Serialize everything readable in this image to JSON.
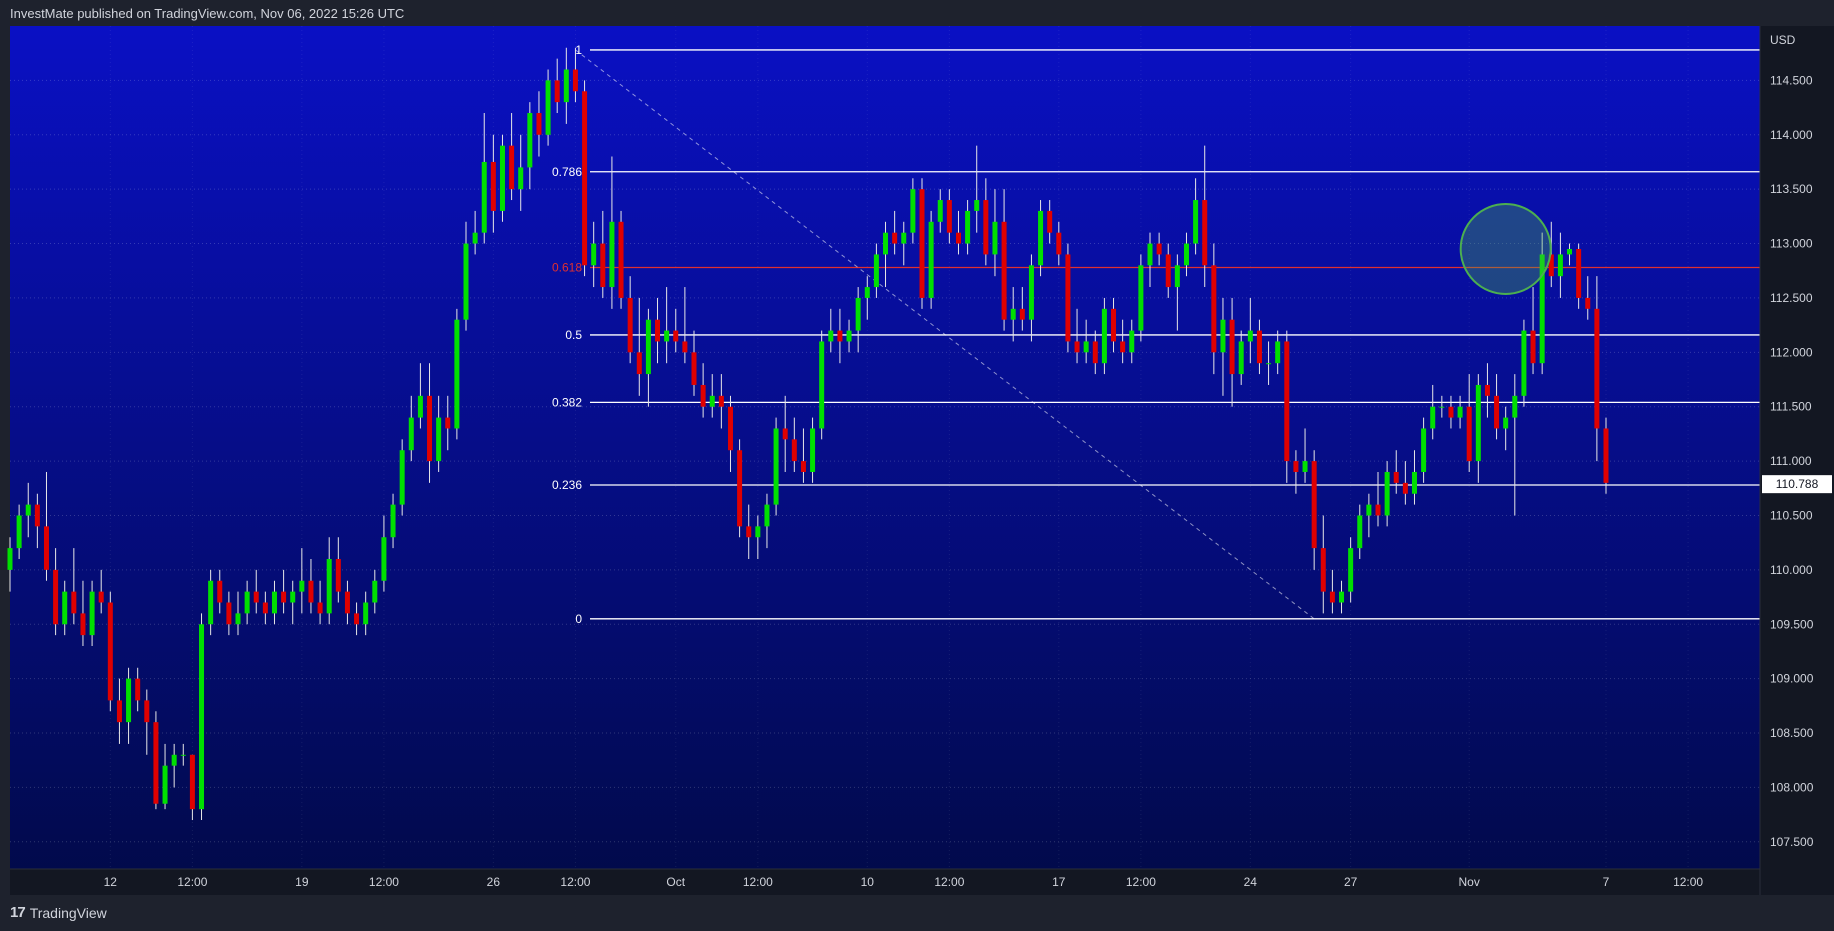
{
  "header": {
    "text": "InvestMate published on TradingView.com, Nov 06, 2022 15:26 UTC"
  },
  "footer": {
    "logo_mark": "17",
    "logo_text": "TradingView"
  },
  "colors": {
    "bg_top": "#0a10c4",
    "bg_bottom": "#010a48",
    "up": "#00e000",
    "down": "#e00000",
    "wick": "#e8e8e8",
    "fib": "#ffffff",
    "fib_highlight": "#e03030",
    "circle": "#4caf50"
  },
  "chart_data": {
    "type": "candlestick",
    "title": "",
    "currency": "USD",
    "last_price": "110.788",
    "ylim": [
      107.25,
      115.0
    ],
    "y_ticks": [
      "107.500",
      "108.000",
      "108.500",
      "109.000",
      "109.500",
      "110.000",
      "110.500",
      "111.000",
      "111.500",
      "112.000",
      "112.500",
      "113.000",
      "113.500",
      "114.000",
      "114.500"
    ],
    "x_ticks": [
      {
        "label": "12",
        "i": 11
      },
      {
        "label": "12:00",
        "i": 20
      },
      {
        "label": "19",
        "i": 32
      },
      {
        "label": "12:00",
        "i": 41
      },
      {
        "label": "26",
        "i": 53
      },
      {
        "label": "12:00",
        "i": 62
      },
      {
        "label": "Oct",
        "i": 73
      },
      {
        "label": "12:00",
        "i": 82
      },
      {
        "label": "10",
        "i": 94
      },
      {
        "label": "12:00",
        "i": 103
      },
      {
        "label": "17",
        "i": 115
      },
      {
        "label": "12:00",
        "i": 124
      },
      {
        "label": "24",
        "i": 136
      },
      {
        "label": "27",
        "i": 147
      },
      {
        "label": "Nov",
        "i": 160
      },
      {
        "label": "7",
        "i": 175
      },
      {
        "label": "12:00",
        "i": 184
      }
    ],
    "fibonacci": {
      "high": 114.78,
      "low": 109.55,
      "levels": [
        {
          "label": "1",
          "price": 114.78
        },
        {
          "label": "0.786",
          "price": 113.66
        },
        {
          "label": "0.618",
          "price": 112.78,
          "highlight": true
        },
        {
          "label": "0.5",
          "price": 112.16
        },
        {
          "label": "0.382",
          "price": 111.54
        },
        {
          "label": "0.236",
          "price": 110.78
        },
        {
          "label": "0",
          "price": 109.55
        }
      ]
    },
    "annotation_circle": {
      "i": 164,
      "price": 112.95
    },
    "trend_line": {
      "from": {
        "i": 62,
        "price": 114.78
      },
      "to": {
        "i": 143,
        "price": 109.55
      }
    },
    "candles": [
      [
        110.0,
        110.3,
        109.8,
        110.2
      ],
      [
        110.2,
        110.6,
        110.1,
        110.5
      ],
      [
        110.5,
        110.8,
        110.3,
        110.6
      ],
      [
        110.6,
        110.7,
        110.2,
        110.4
      ],
      [
        110.4,
        110.9,
        109.9,
        110.0
      ],
      [
        110.0,
        110.2,
        109.4,
        109.5
      ],
      [
        109.5,
        109.9,
        109.4,
        109.8
      ],
      [
        109.8,
        110.2,
        109.5,
        109.6
      ],
      [
        109.6,
        109.9,
        109.3,
        109.4
      ],
      [
        109.4,
        109.9,
        109.3,
        109.8
      ],
      [
        109.8,
        110.0,
        109.6,
        109.7
      ],
      [
        109.7,
        109.8,
        108.7,
        108.8
      ],
      [
        108.8,
        109.0,
        108.4,
        108.6
      ],
      [
        108.6,
        109.1,
        108.4,
        109.0
      ],
      [
        109.0,
        109.1,
        108.7,
        108.8
      ],
      [
        108.8,
        108.9,
        108.3,
        108.6
      ],
      [
        108.6,
        108.7,
        107.8,
        107.85
      ],
      [
        107.85,
        108.4,
        107.8,
        108.2
      ],
      [
        108.2,
        108.4,
        108.0,
        108.3
      ],
      [
        108.3,
        108.4,
        108.2,
        108.3
      ],
      [
        108.3,
        108.3,
        107.7,
        107.8
      ],
      [
        107.8,
        109.6,
        107.7,
        109.5
      ],
      [
        109.5,
        110.0,
        109.4,
        109.9
      ],
      [
        109.9,
        110.0,
        109.6,
        109.7
      ],
      [
        109.7,
        109.8,
        109.4,
        109.5
      ],
      [
        109.5,
        109.8,
        109.4,
        109.6
      ],
      [
        109.6,
        109.9,
        109.5,
        109.8
      ],
      [
        109.8,
        110.0,
        109.6,
        109.7
      ],
      [
        109.7,
        109.8,
        109.5,
        109.6
      ],
      [
        109.6,
        109.9,
        109.5,
        109.8
      ],
      [
        109.8,
        110.0,
        109.6,
        109.7
      ],
      [
        109.7,
        109.9,
        109.5,
        109.8
      ],
      [
        109.8,
        110.2,
        109.6,
        109.9
      ],
      [
        109.9,
        110.1,
        109.6,
        109.7
      ],
      [
        109.7,
        109.9,
        109.5,
        109.6
      ],
      [
        109.6,
        110.3,
        109.5,
        110.1
      ],
      [
        110.1,
        110.3,
        109.7,
        109.8
      ],
      [
        109.8,
        109.9,
        109.5,
        109.6
      ],
      [
        109.6,
        109.7,
        109.4,
        109.5
      ],
      [
        109.5,
        109.8,
        109.4,
        109.7
      ],
      [
        109.7,
        110.0,
        109.6,
        109.9
      ],
      [
        109.9,
        110.5,
        109.8,
        110.3
      ],
      [
        110.3,
        110.7,
        110.2,
        110.6
      ],
      [
        110.6,
        111.2,
        110.5,
        111.1
      ],
      [
        111.1,
        111.6,
        111.0,
        111.4
      ],
      [
        111.4,
        111.9,
        111.3,
        111.6
      ],
      [
        111.6,
        111.9,
        110.8,
        111.0
      ],
      [
        111.0,
        111.6,
        110.9,
        111.4
      ],
      [
        111.4,
        111.6,
        111.1,
        111.3
      ],
      [
        111.3,
        112.4,
        111.2,
        112.3
      ],
      [
        112.3,
        113.2,
        112.2,
        113.0
      ],
      [
        113.0,
        113.3,
        112.9,
        113.1
      ],
      [
        113.1,
        114.2,
        113.0,
        113.75
      ],
      [
        113.75,
        114.0,
        113.1,
        113.3
      ],
      [
        113.3,
        114.0,
        113.2,
        113.9
      ],
      [
        113.9,
        114.2,
        113.4,
        113.5
      ],
      [
        113.5,
        114.0,
        113.3,
        113.7
      ],
      [
        113.7,
        114.3,
        113.5,
        114.2
      ],
      [
        114.2,
        114.4,
        113.8,
        114.0
      ],
      [
        114.0,
        114.6,
        113.9,
        114.5
      ],
      [
        114.5,
        114.7,
        114.2,
        114.3
      ],
      [
        114.3,
        114.8,
        114.1,
        114.6
      ],
      [
        114.6,
        114.8,
        114.3,
        114.4
      ],
      [
        114.4,
        114.5,
        112.7,
        112.8
      ],
      [
        112.8,
        113.2,
        112.6,
        113.0
      ],
      [
        113.0,
        113.3,
        112.5,
        112.6
      ],
      [
        112.6,
        113.8,
        112.4,
        113.2
      ],
      [
        113.2,
        113.3,
        112.4,
        112.5
      ],
      [
        112.5,
        112.7,
        111.9,
        112.0
      ],
      [
        112.0,
        112.5,
        111.6,
        111.8
      ],
      [
        111.8,
        112.4,
        111.5,
        112.3
      ],
      [
        112.3,
        112.5,
        111.9,
        112.1
      ],
      [
        112.1,
        112.6,
        111.9,
        112.2
      ],
      [
        112.2,
        112.4,
        112.0,
        112.1
      ],
      [
        112.1,
        112.6,
        111.9,
        112.0
      ],
      [
        112.0,
        112.2,
        111.6,
        111.7
      ],
      [
        111.7,
        111.9,
        111.4,
        111.5
      ],
      [
        111.5,
        111.8,
        111.4,
        111.6
      ],
      [
        111.6,
        111.8,
        111.3,
        111.5
      ],
      [
        111.5,
        111.6,
        110.9,
        111.1
      ],
      [
        111.1,
        111.2,
        110.3,
        110.4
      ],
      [
        110.4,
        110.6,
        110.1,
        110.3
      ],
      [
        110.3,
        110.5,
        110.1,
        110.4
      ],
      [
        110.4,
        110.7,
        110.2,
        110.6
      ],
      [
        110.6,
        111.4,
        110.5,
        111.3
      ],
      [
        111.3,
        111.6,
        110.9,
        111.2
      ],
      [
        111.2,
        111.4,
        110.9,
        111.0
      ],
      [
        111.0,
        111.3,
        110.8,
        110.9
      ],
      [
        110.9,
        111.4,
        110.8,
        111.3
      ],
      [
        111.3,
        112.2,
        111.2,
        112.1
      ],
      [
        112.1,
        112.4,
        112.0,
        112.2
      ],
      [
        112.2,
        112.4,
        111.9,
        112.1
      ],
      [
        112.1,
        112.3,
        112.0,
        112.2
      ],
      [
        112.2,
        112.6,
        112.0,
        112.5
      ],
      [
        112.5,
        112.7,
        112.3,
        112.6
      ],
      [
        112.6,
        113.0,
        112.5,
        112.9
      ],
      [
        112.9,
        113.2,
        112.6,
        113.1
      ],
      [
        113.1,
        113.3,
        112.9,
        113.0
      ],
      [
        113.0,
        113.2,
        112.8,
        113.1
      ],
      [
        113.1,
        113.6,
        113.0,
        113.5
      ],
      [
        113.5,
        113.6,
        112.4,
        112.5
      ],
      [
        112.5,
        113.3,
        112.4,
        113.2
      ],
      [
        113.2,
        113.5,
        113.1,
        113.4
      ],
      [
        113.4,
        113.5,
        113.0,
        113.1
      ],
      [
        113.1,
        113.3,
        112.9,
        113.0
      ],
      [
        113.0,
        113.4,
        112.9,
        113.3
      ],
      [
        113.3,
        113.9,
        113.1,
        113.4
      ],
      [
        113.4,
        113.6,
        112.8,
        112.9
      ],
      [
        112.9,
        113.5,
        112.7,
        113.2
      ],
      [
        113.2,
        113.5,
        112.2,
        112.3
      ],
      [
        112.3,
        112.6,
        112.1,
        112.4
      ],
      [
        112.4,
        112.6,
        112.2,
        112.3
      ],
      [
        112.3,
        112.9,
        112.1,
        112.8
      ],
      [
        112.8,
        113.4,
        112.7,
        113.3
      ],
      [
        113.3,
        113.4,
        113.0,
        113.1
      ],
      [
        113.1,
        113.2,
        112.8,
        112.9
      ],
      [
        112.9,
        113.0,
        112.0,
        112.1
      ],
      [
        112.1,
        112.4,
        111.9,
        112.0
      ],
      [
        112.0,
        112.3,
        111.9,
        112.1
      ],
      [
        112.1,
        112.2,
        111.8,
        111.9
      ],
      [
        111.9,
        112.5,
        111.8,
        112.4
      ],
      [
        112.4,
        112.5,
        112.0,
        112.1
      ],
      [
        112.1,
        112.3,
        111.9,
        112.0
      ],
      [
        112.0,
        112.3,
        111.9,
        112.2
      ],
      [
        112.2,
        112.9,
        112.1,
        112.8
      ],
      [
        112.8,
        113.1,
        112.6,
        113.0
      ],
      [
        113.0,
        113.1,
        112.8,
        112.9
      ],
      [
        112.9,
        113.0,
        112.5,
        112.6
      ],
      [
        112.6,
        112.9,
        112.2,
        112.8
      ],
      [
        112.8,
        113.1,
        112.7,
        113.0
      ],
      [
        113.0,
        113.6,
        112.9,
        113.4
      ],
      [
        113.4,
        113.9,
        112.6,
        112.8
      ],
      [
        112.8,
        113.0,
        111.8,
        112.0
      ],
      [
        112.0,
        112.5,
        111.6,
        112.3
      ],
      [
        112.3,
        112.5,
        111.5,
        111.8
      ],
      [
        111.8,
        112.2,
        111.7,
        112.1
      ],
      [
        112.1,
        112.5,
        111.9,
        112.2
      ],
      [
        112.2,
        112.3,
        111.8,
        111.9
      ],
      [
        111.9,
        112.1,
        111.7,
        111.9
      ],
      [
        111.9,
        112.2,
        111.8,
        112.1
      ],
      [
        112.1,
        112.2,
        110.8,
        111.0
      ],
      [
        111.0,
        111.1,
        110.7,
        110.9
      ],
      [
        110.9,
        111.3,
        110.8,
        111.0
      ],
      [
        111.0,
        111.1,
        110.0,
        110.2
      ],
      [
        110.2,
        110.5,
        109.6,
        109.8
      ],
      [
        109.8,
        110.0,
        109.6,
        109.7
      ],
      [
        109.7,
        109.9,
        109.6,
        109.8
      ],
      [
        109.8,
        110.3,
        109.7,
        110.2
      ],
      [
        110.2,
        110.6,
        110.1,
        110.5
      ],
      [
        110.5,
        110.7,
        110.3,
        110.6
      ],
      [
        110.6,
        110.9,
        110.4,
        110.5
      ],
      [
        110.5,
        111.0,
        110.4,
        110.9
      ],
      [
        110.9,
        111.1,
        110.7,
        110.8
      ],
      [
        110.8,
        111.0,
        110.6,
        110.7
      ],
      [
        110.7,
        111.1,
        110.6,
        110.9
      ],
      [
        110.9,
        111.4,
        110.8,
        111.3
      ],
      [
        111.3,
        111.7,
        111.2,
        111.5
      ],
      [
        111.5,
        111.6,
        111.4,
        111.5
      ],
      [
        111.5,
        111.6,
        111.3,
        111.4
      ],
      [
        111.4,
        111.6,
        111.3,
        111.5
      ],
      [
        111.5,
        111.8,
        110.9,
        111.0
      ],
      [
        111.0,
        111.8,
        110.8,
        111.7
      ],
      [
        111.7,
        111.9,
        111.4,
        111.6
      ],
      [
        111.6,
        111.8,
        111.2,
        111.3
      ],
      [
        111.3,
        111.5,
        111.1,
        111.4
      ],
      [
        111.4,
        111.8,
        110.5,
        111.6
      ],
      [
        111.6,
        112.3,
        111.5,
        112.2
      ],
      [
        112.2,
        112.6,
        111.8,
        111.9
      ],
      [
        111.9,
        113.1,
        111.8,
        112.9
      ],
      [
        112.9,
        113.2,
        112.6,
        112.7
      ],
      [
        112.7,
        113.1,
        112.5,
        112.9
      ],
      [
        112.9,
        113.0,
        112.8,
        112.95
      ],
      [
        112.95,
        113.0,
        112.4,
        112.5
      ],
      [
        112.5,
        112.7,
        112.3,
        112.4
      ],
      [
        112.4,
        112.7,
        111.0,
        111.3
      ],
      [
        111.3,
        111.4,
        110.7,
        110.8
      ]
    ]
  }
}
